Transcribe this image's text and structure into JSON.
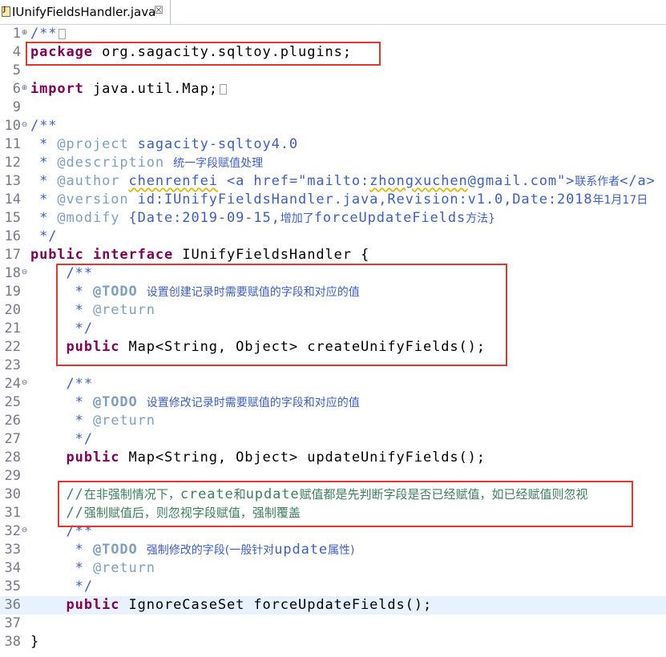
{
  "tab": {
    "title": "IUnifyFieldsHandler.java",
    "close": "☒"
  },
  "editor": {
    "lines": [
      {
        "n": "1",
        "fold": "+",
        "parts": [
          [
            "cm",
            "/**"
          ],
          [
            "box",
            ""
          ]
        ]
      },
      {
        "n": "4",
        "fold": "",
        "parts": [
          [
            "kw",
            "package"
          ],
          [
            "txt",
            " org.sagacity.sqltoy.plugins;"
          ]
        ]
      },
      {
        "n": "5",
        "fold": "",
        "parts": []
      },
      {
        "n": "6",
        "fold": "+",
        "parts": [
          [
            "kw",
            "import"
          ],
          [
            "txt",
            " java.util.Map;"
          ],
          [
            "box",
            ""
          ]
        ]
      },
      {
        "n": "9",
        "fold": "",
        "parts": []
      },
      {
        "n": "10",
        "fold": "-",
        "parts": [
          [
            "cm",
            "/**"
          ]
        ]
      },
      {
        "n": "11",
        "fold": "",
        "parts": [
          [
            "cm",
            " * "
          ],
          [
            "tag",
            "@project"
          ],
          [
            "cm",
            " sagacity-sqltoy4.0"
          ]
        ]
      },
      {
        "n": "12",
        "fold": "",
        "parts": [
          [
            "cm",
            " * "
          ],
          [
            "tag",
            "@description"
          ],
          [
            "cm",
            " "
          ],
          [
            "zh",
            "统一字段赋值处理"
          ]
        ]
      },
      {
        "n": "13",
        "fold": "",
        "parts": [
          [
            "cm",
            " * "
          ],
          [
            "tag",
            "@author"
          ],
          [
            "cm",
            " "
          ],
          [
            "ulcm",
            "chenrenfei"
          ],
          [
            "cm",
            " <a href=\"mailto:"
          ],
          [
            "ulcm",
            "zhongxuchen"
          ],
          [
            "cm",
            "@gmail.com\">"
          ],
          [
            "zh",
            "联系作者"
          ],
          [
            "cm",
            "</a>"
          ]
        ]
      },
      {
        "n": "14",
        "fold": "",
        "parts": [
          [
            "cm",
            " * "
          ],
          [
            "tag",
            "@version"
          ],
          [
            "cm",
            " id:IUnifyFieldsHandler.java,Revision:v1.0,Date:2018"
          ],
          [
            "zh",
            "年1月17日"
          ]
        ]
      },
      {
        "n": "15",
        "fold": "",
        "parts": [
          [
            "cm",
            " * "
          ],
          [
            "tag",
            "@modify"
          ],
          [
            "cm",
            " {Date:2019-09-15,"
          ],
          [
            "zh",
            "增加了"
          ],
          [
            "cm",
            "forceUpdateFields"
          ],
          [
            "zh",
            "方法}"
          ]
        ]
      },
      {
        "n": "16",
        "fold": "",
        "parts": [
          [
            "cm",
            " */"
          ]
        ]
      },
      {
        "n": "17",
        "fold": "",
        "parts": [
          [
            "kw",
            "public"
          ],
          [
            "txt",
            " "
          ],
          [
            "kw",
            "interface"
          ],
          [
            "txt",
            " IUnifyFieldsHandler {"
          ]
        ]
      },
      {
        "n": "18",
        "fold": "-",
        "parts": [
          [
            "txt",
            "    "
          ],
          [
            "cm",
            "/**"
          ]
        ]
      },
      {
        "n": "19",
        "fold": "",
        "parts": [
          [
            "txt",
            "    "
          ],
          [
            "cm",
            " * "
          ],
          [
            "todo",
            "@TODO"
          ],
          [
            "cm",
            " "
          ],
          [
            "zh",
            "设置创建记录时需要赋值的字段和对应的值"
          ]
        ]
      },
      {
        "n": "20",
        "fold": "",
        "parts": [
          [
            "txt",
            "    "
          ],
          [
            "cm",
            " * "
          ],
          [
            "tag",
            "@return"
          ]
        ]
      },
      {
        "n": "21",
        "fold": "",
        "parts": [
          [
            "txt",
            "    "
          ],
          [
            "cm",
            " */"
          ]
        ]
      },
      {
        "n": "22",
        "fold": "",
        "parts": [
          [
            "txt",
            "    "
          ],
          [
            "kw",
            "public"
          ],
          [
            "txt",
            " Map<String, Object> createUnifyFields();"
          ]
        ]
      },
      {
        "n": "23",
        "fold": "",
        "parts": []
      },
      {
        "n": "24",
        "fold": "-",
        "parts": [
          [
            "txt",
            "    "
          ],
          [
            "cm",
            "/**"
          ]
        ]
      },
      {
        "n": "25",
        "fold": "",
        "parts": [
          [
            "txt",
            "    "
          ],
          [
            "cm",
            " * "
          ],
          [
            "todo",
            "@TODO"
          ],
          [
            "cm",
            " "
          ],
          [
            "zh",
            "设置修改记录时需要赋值的字段和对应的值"
          ]
        ]
      },
      {
        "n": "26",
        "fold": "",
        "parts": [
          [
            "txt",
            "    "
          ],
          [
            "cm",
            " * "
          ],
          [
            "tag",
            "@return"
          ]
        ]
      },
      {
        "n": "27",
        "fold": "",
        "parts": [
          [
            "txt",
            "    "
          ],
          [
            "cm",
            " */"
          ]
        ]
      },
      {
        "n": "28",
        "fold": "",
        "parts": [
          [
            "txt",
            "    "
          ],
          [
            "kw",
            "public"
          ],
          [
            "txt",
            " Map<String, Object> updateUnifyFields();"
          ]
        ]
      },
      {
        "n": "29",
        "fold": "",
        "parts": []
      },
      {
        "n": "30",
        "fold": "",
        "parts": [
          [
            "txt",
            "    "
          ],
          [
            "lc",
            "//"
          ],
          [
            "zhlc",
            "在非强制情况下，"
          ],
          [
            "lc",
            "create"
          ],
          [
            "zhlc",
            "和"
          ],
          [
            "lc",
            "update"
          ],
          [
            "zhlc",
            "赋值都是先判断字段是否已经赋值，如已经赋值则忽视"
          ]
        ]
      },
      {
        "n": "31",
        "fold": "",
        "parts": [
          [
            "txt",
            "    "
          ],
          [
            "lc",
            "//"
          ],
          [
            "zhlc",
            "强制赋值后，则忽视字段赋值，强制覆盖"
          ]
        ]
      },
      {
        "n": "32",
        "fold": "-",
        "parts": [
          [
            "txt",
            "    "
          ],
          [
            "cm",
            "/**"
          ]
        ]
      },
      {
        "n": "33",
        "fold": "",
        "parts": [
          [
            "txt",
            "    "
          ],
          [
            "cm",
            " * "
          ],
          [
            "todo",
            "@TODO"
          ],
          [
            "cm",
            " "
          ],
          [
            "zh",
            "强制修改的字段(一般针对"
          ],
          [
            "cm",
            "update"
          ],
          [
            "zh",
            "属性)"
          ]
        ]
      },
      {
        "n": "34",
        "fold": "",
        "parts": [
          [
            "txt",
            "    "
          ],
          [
            "cm",
            " * "
          ],
          [
            "tag",
            "@return"
          ]
        ]
      },
      {
        "n": "35",
        "fold": "",
        "parts": [
          [
            "txt",
            "    "
          ],
          [
            "cm",
            " */"
          ]
        ]
      },
      {
        "n": "36",
        "fold": "",
        "parts": [
          [
            "txt",
            "    "
          ],
          [
            "kw",
            "public"
          ],
          [
            "txt",
            " IgnoreCaseSet forceUpdateFields();"
          ]
        ],
        "current": true
      },
      {
        "n": "37",
        "fold": "",
        "parts": []
      },
      {
        "n": "38",
        "fold": "",
        "parts": [
          [
            "txt",
            "}"
          ]
        ]
      }
    ]
  },
  "colors": {
    "highlight_box": "#e4352f",
    "keyword": "#7f0055",
    "javadoc": "#3f5fbf",
    "line_comment": "#3f7f5f"
  }
}
